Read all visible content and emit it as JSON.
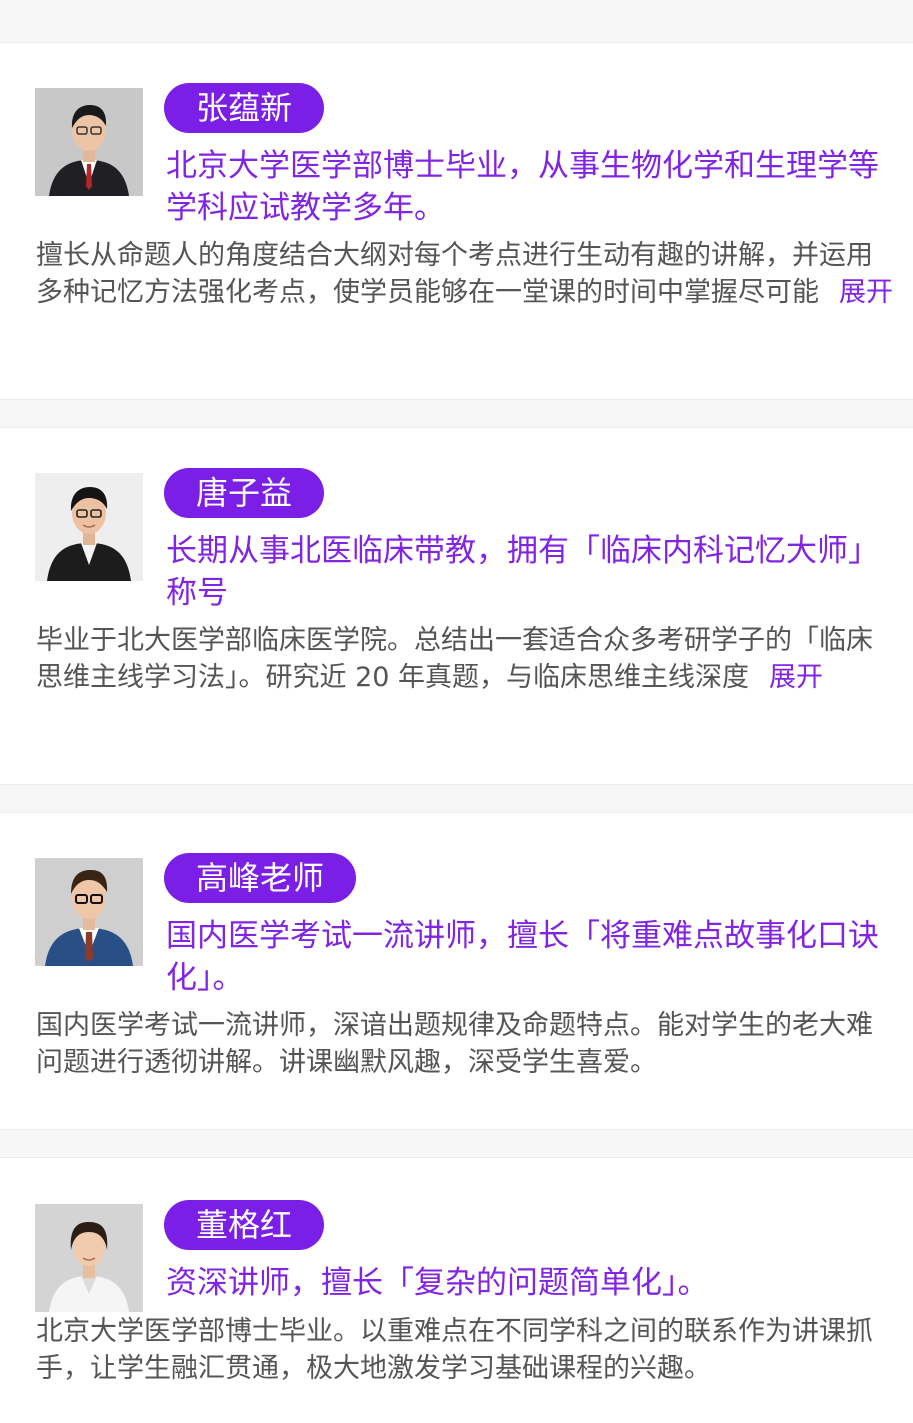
{
  "teachers": [
    {
      "name": "张蕴新",
      "headline": "北京大学医学部博士毕业，从事生物化学和生理学等学科应试教学多年。",
      "description": "擅长从命题人的角度结合大纲对每个考点进行生动有趣的讲解，并运用多种记忆方法强化考点，使学员能够在一堂课的时间中掌握尽可能",
      "expand_label": "展开"
    },
    {
      "name": "唐子益",
      "headline": "长期从事北医临床带教，拥有「临床内科记忆大师」称号",
      "description": "毕业于北大医学部临床医学院。总结出一套适合众多考研学子的「临床思维主线学习法」。研究近 20 年真题，与临床思维主线深度",
      "expand_label": "展开"
    },
    {
      "name": "高峰老师",
      "headline": "国内医学考试一流讲师，擅长「将重难点故事化口诀化」。",
      "description": "国内医学考试一流讲师，深谙出题规律及命题特点。能对学生的老大难问题进行透彻讲解。讲课幽默风趣，深受学生喜爱。"
    },
    {
      "name": "董格红",
      "headline": "资深讲师，擅长「复杂的问题简单化」。",
      "description": "北京大学医学部博士毕业。以重难点在不同学科之间的联系作为讲课抓手，让学生融汇贯通，极大地激发学习基础课程的兴趣。"
    }
  ],
  "colors": {
    "accent": "#7b1fe6",
    "headline_text": "#8224e3",
    "body_text": "#555555",
    "background": "#f7f7f7"
  }
}
